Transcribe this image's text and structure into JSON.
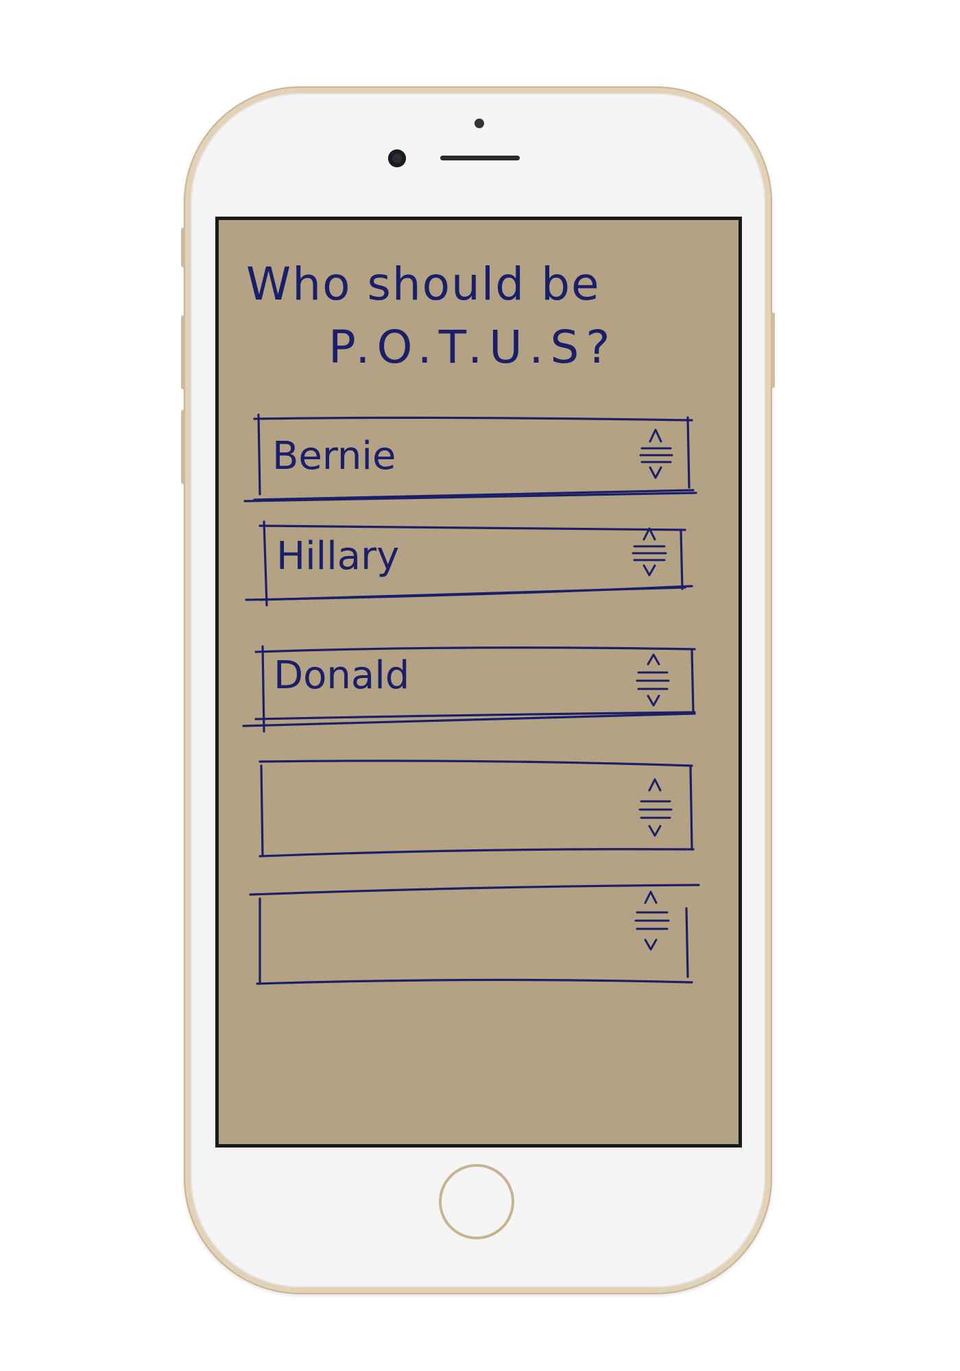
{
  "question": {
    "line1": "Who should be",
    "line2": "P.O.T.U.S?"
  },
  "pickers": [
    {
      "value": "Bernie",
      "icon": "stepper-icon"
    },
    {
      "value": "Hillary",
      "icon": "stepper-icon"
    },
    {
      "value": "Donald",
      "icon": "stepper-icon"
    },
    {
      "value": "",
      "icon": "stepper-icon"
    },
    {
      "value": "",
      "icon": "stepper-icon"
    }
  ],
  "colors": {
    "ink": "#1b1f6a",
    "paper": "#b3a284",
    "phone_frame": "#e2d2b8"
  }
}
